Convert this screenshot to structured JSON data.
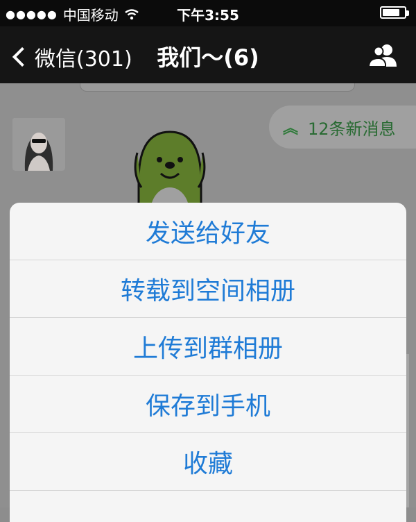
{
  "status_bar": {
    "signal": "●●●●●",
    "carrier": "中国移动",
    "wifi": "wifi-icon",
    "time": "下午3:55",
    "battery_level": 0.8
  },
  "nav": {
    "back_label": "微信(301)",
    "title": "我们～(6)",
    "right_icon": "group-people-icon"
  },
  "chat": {
    "new_messages_label": "12条新消息",
    "accent": "#2f7a3a"
  },
  "action_sheet": {
    "items": [
      {
        "label": "发送给好友"
      },
      {
        "label": "转载到空间相册"
      },
      {
        "label": "上传到群相册"
      },
      {
        "label": "保存到手机"
      },
      {
        "label": "收藏"
      }
    ],
    "accent": "#1f7bd6"
  }
}
